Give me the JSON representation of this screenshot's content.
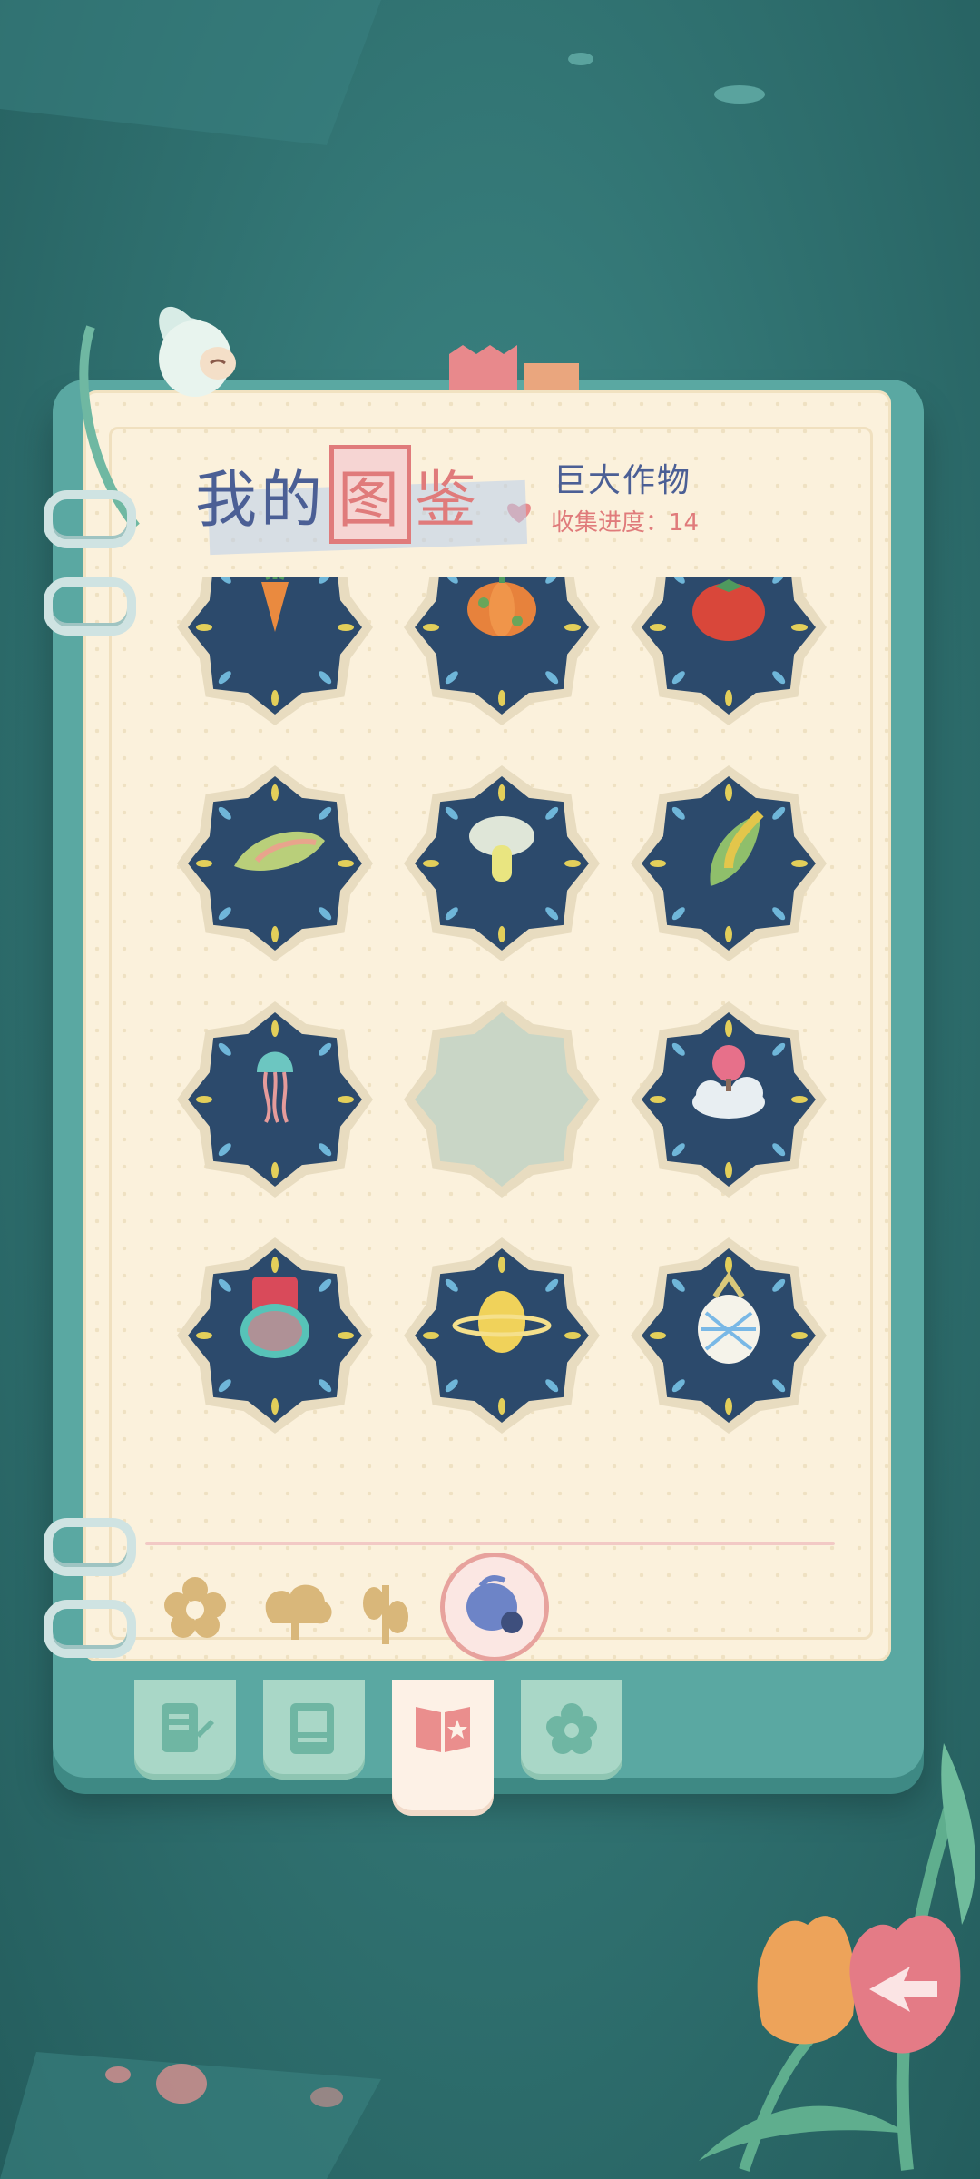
{
  "title": {
    "part1": "我的",
    "highlight1": "图",
    "highlight2": "鉴"
  },
  "category_title": "巨大作物",
  "progress_label": "收集进度：14",
  "colors": {
    "background": "#2f706f",
    "page": "#fbf1dc",
    "title": "#4b5f95",
    "accent_pink": "#e07b7b",
    "badge_dark": "#2c4a6c",
    "badge_ring": "#e8dcc0"
  },
  "collection": [
    {
      "name": "carrot",
      "icon": "carrot-icon",
      "collected": true
    },
    {
      "name": "pumpkin",
      "icon": "pumpkin-icon",
      "collected": true
    },
    {
      "name": "tomato",
      "icon": "tomato-icon",
      "collected": true
    },
    {
      "name": "bamboo-shoot",
      "icon": "bamboo-shoot-icon",
      "collected": true
    },
    {
      "name": "mushroom",
      "icon": "mushroom-icon",
      "collected": true
    },
    {
      "name": "corn",
      "icon": "corn-icon",
      "collected": true
    },
    {
      "name": "jellyfish",
      "icon": "jellyfish-icon",
      "collected": true
    },
    {
      "name": "locked",
      "icon": "locked-slot-icon",
      "collected": false
    },
    {
      "name": "cloud-fruit",
      "icon": "cloud-fruit-icon",
      "collected": true
    },
    {
      "name": "jar-fruit",
      "icon": "jar-fruit-icon",
      "collected": true
    },
    {
      "name": "planet-lemon",
      "icon": "planet-lemon-icon",
      "collected": true
    },
    {
      "name": "crystal-pineapple",
      "icon": "crystal-pineapple-icon",
      "collected": true
    }
  ],
  "category_tabs": [
    {
      "icon": "flower-icon",
      "active": false
    },
    {
      "icon": "tree-icon",
      "active": false
    },
    {
      "icon": "plant-icon",
      "active": false
    },
    {
      "icon": "giant-crop-icon",
      "active": true
    }
  ],
  "bottom_tabs": [
    {
      "icon": "notebook-edit-icon",
      "active": false
    },
    {
      "icon": "photo-album-icon",
      "active": false
    },
    {
      "icon": "encyclopedia-icon",
      "active": true
    },
    {
      "icon": "flower-badge-icon",
      "active": false
    }
  ]
}
